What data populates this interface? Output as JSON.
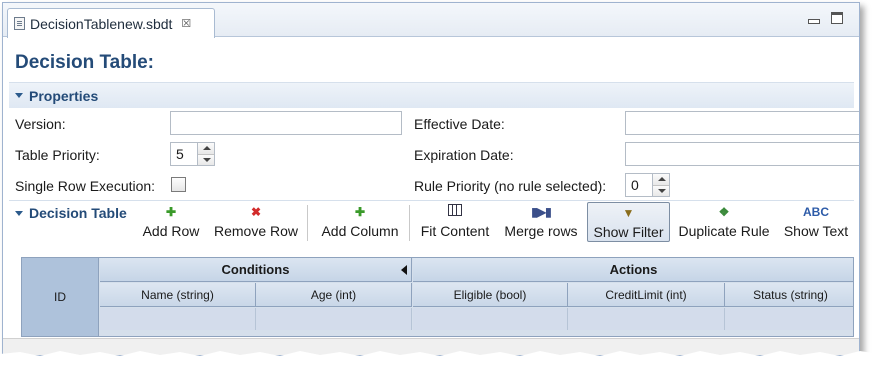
{
  "tab": {
    "title": "DecisionTablenew.sbdt",
    "close_glyph": "☒"
  },
  "page": {
    "title": "Decision Table:"
  },
  "properties": {
    "section_title": "Properties",
    "version_label": "Version:",
    "version_value": "",
    "effective_date_label": "Effective Date:",
    "effective_date_value": "",
    "table_priority_label": "Table Priority:",
    "table_priority_value": "5",
    "expiration_date_label": "Expiration Date:",
    "expiration_date_value": "",
    "single_row_label": "Single Row Execution:",
    "single_row_checked": false,
    "rule_priority_label": "Rule Priority (no rule selected):",
    "rule_priority_value": "0"
  },
  "decision_table": {
    "section_title": "Decision Table",
    "toolbar": [
      {
        "label": "Add Row",
        "icon": "plus-icon"
      },
      {
        "label": "Remove Row",
        "icon": "x-icon"
      },
      {
        "label": "Add Column",
        "icon": "plus-icon"
      },
      {
        "label": "Fit Content",
        "icon": "grid-icon"
      },
      {
        "label": "Merge rows",
        "icon": "merge-icon"
      },
      {
        "label": "Show Filter",
        "icon": "filter-icon",
        "pressed": true
      },
      {
        "label": "Duplicate Rule",
        "icon": "duplicate-icon"
      },
      {
        "label": "Show Text",
        "icon": "abc-icon"
      }
    ],
    "grid": {
      "id_header": "ID",
      "conditions_header": "Conditions",
      "actions_header": "Actions",
      "columns": [
        {
          "label": "Name (string)",
          "group": "conditions"
        },
        {
          "label": "Age (int)",
          "group": "conditions"
        },
        {
          "label": "Eligible (bool)",
          "group": "actions"
        },
        {
          "label": "CreditLimit (int)",
          "group": "actions"
        },
        {
          "label": "Status (string)",
          "group": "actions"
        }
      ]
    }
  },
  "colors": {
    "title_blue": "#244b78",
    "header_fill": "#c6d5e7",
    "id_fill": "#aec2db",
    "grid_border": "#8ea2bd"
  }
}
